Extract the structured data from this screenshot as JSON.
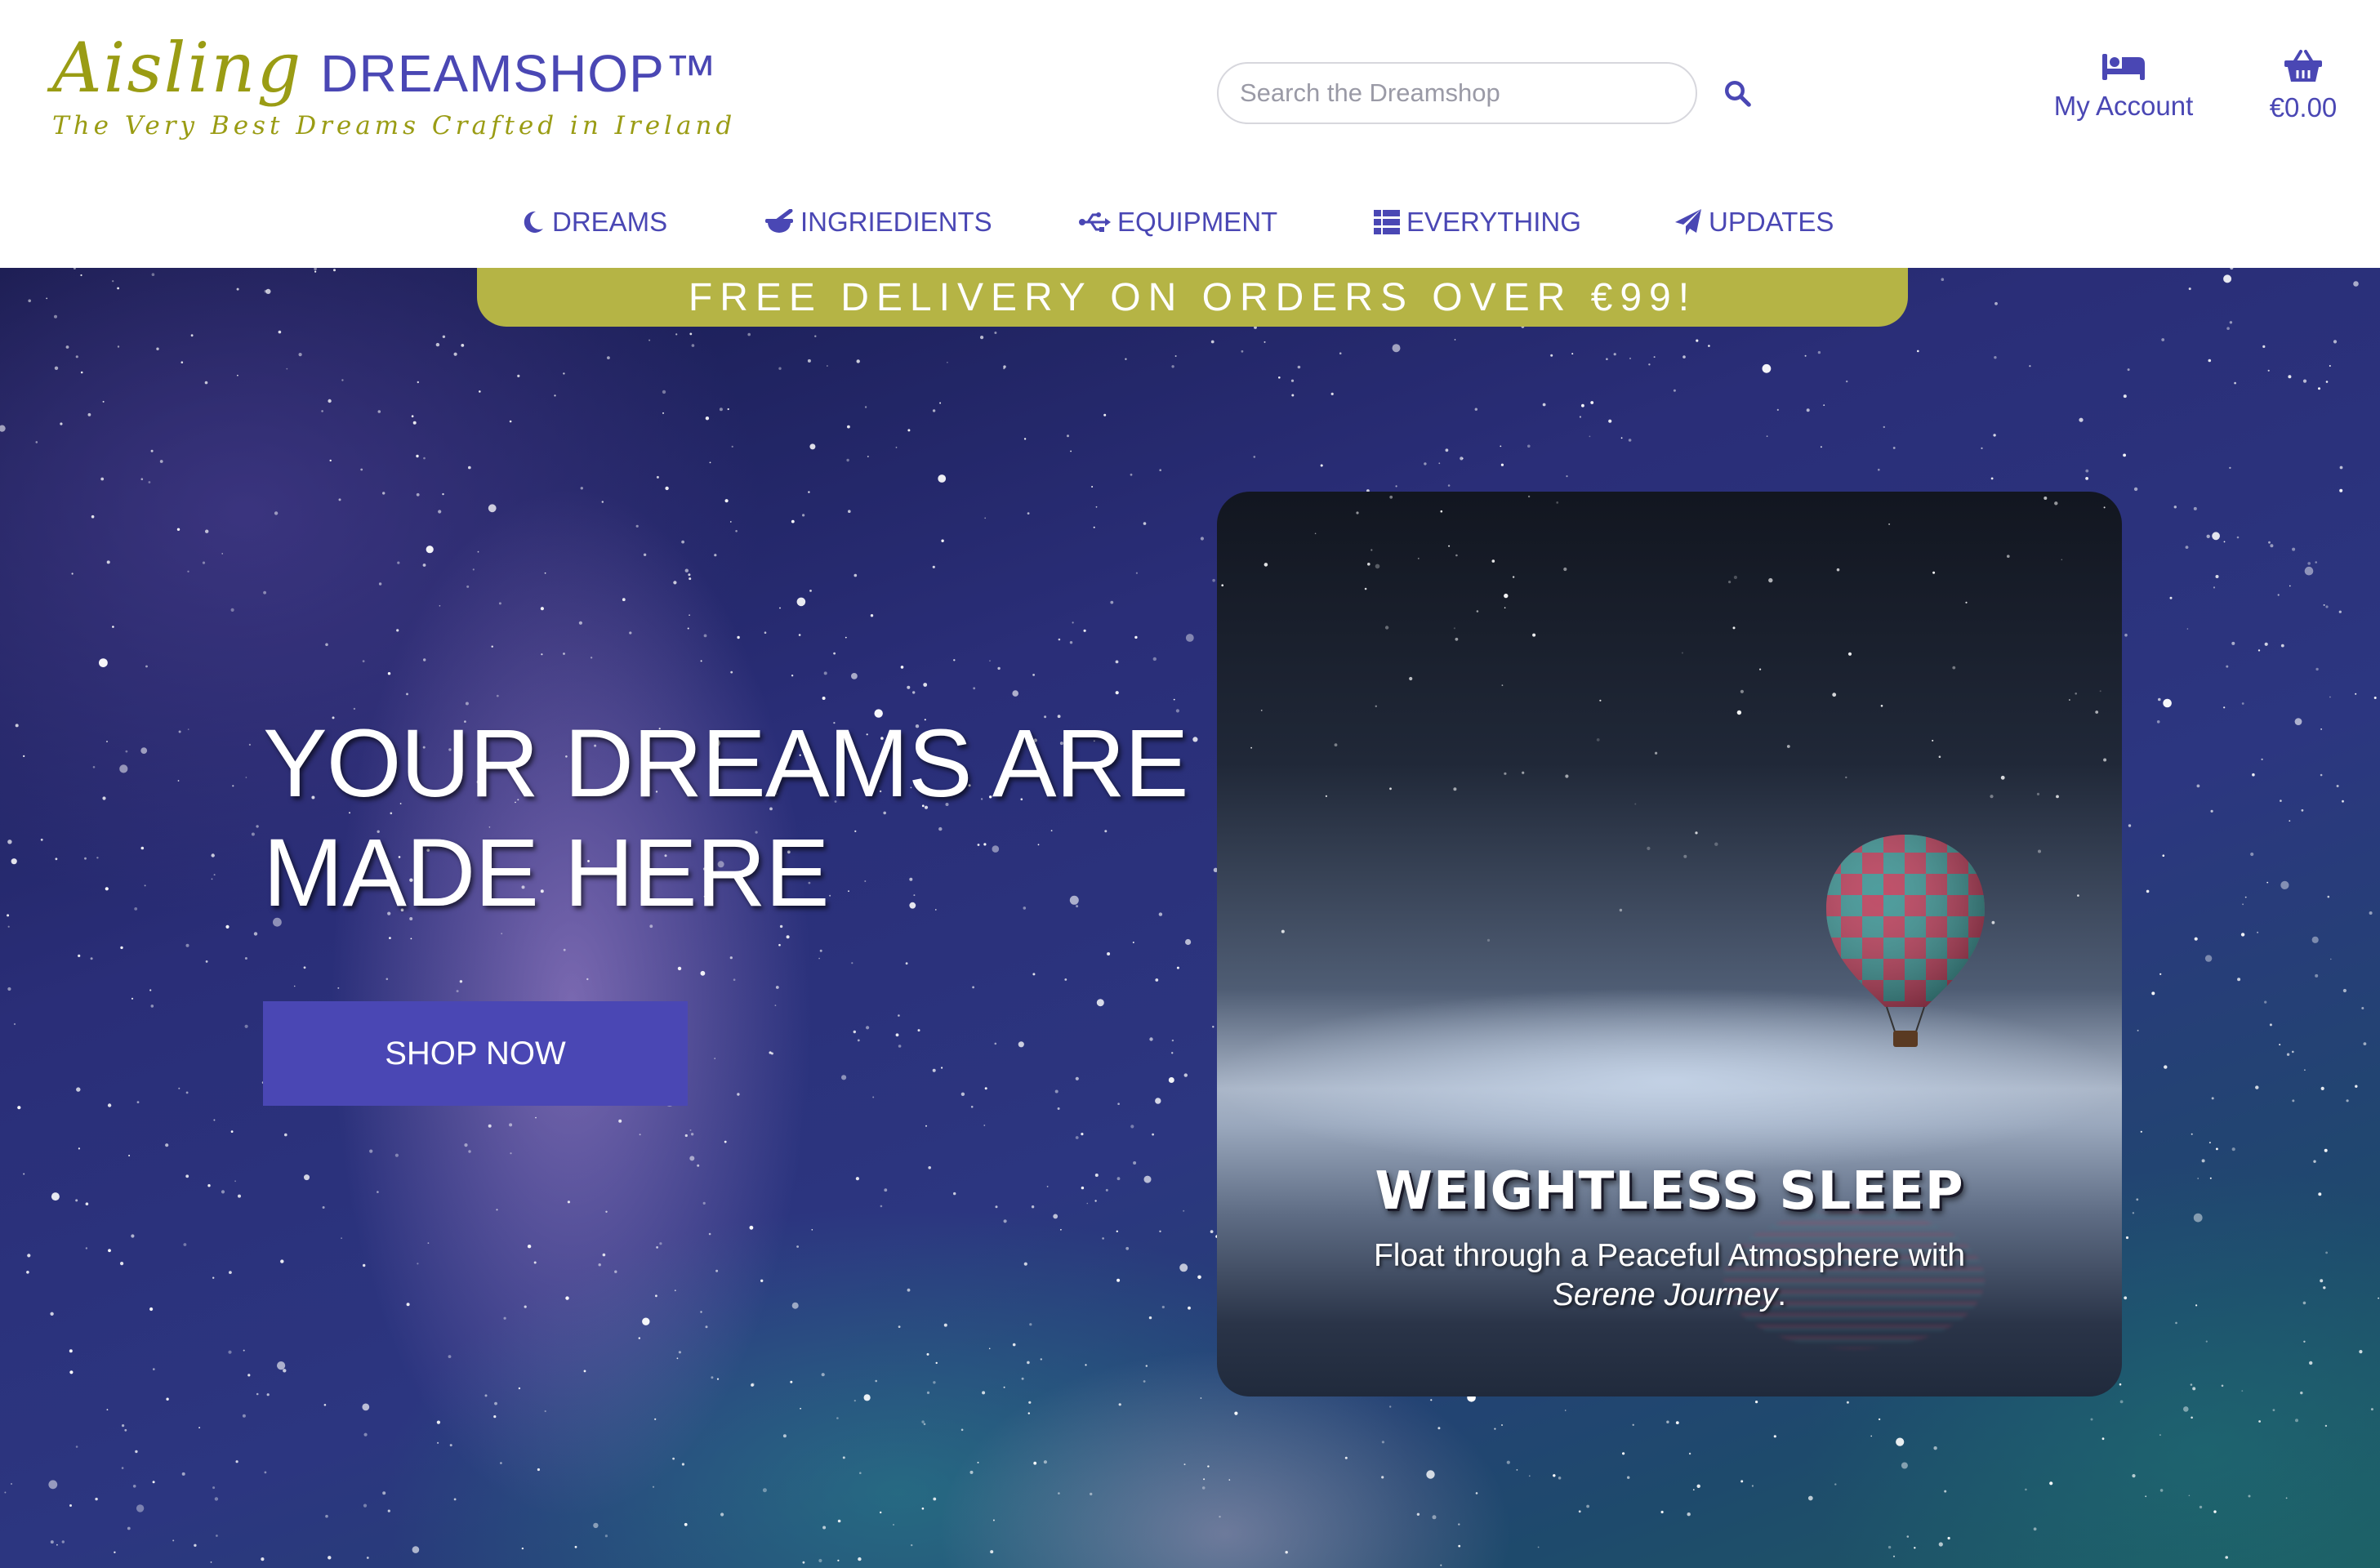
{
  "header": {
    "brand_script": "Aisling",
    "brand_name": "DREAMSHOP™",
    "tagline": "The Very Best Dreams Crafted in Ireland",
    "search_placeholder": "Search the Dreamshop",
    "account_label": "My Account",
    "cart_total": "€0.00"
  },
  "nav": [
    {
      "label": "DREAMS",
      "icon": "moon-icon"
    },
    {
      "label": "INGRIEDIENTS",
      "icon": "mortar-pestle-icon"
    },
    {
      "label": "EQUIPMENT",
      "icon": "usb-icon"
    },
    {
      "label": "EVERYTHING",
      "icon": "grid-icon"
    },
    {
      "label": "UPDATES",
      "icon": "paper-plane-icon"
    }
  ],
  "promo": "FREE DELIVERY ON ORDERS OVER €99!",
  "hero": {
    "title": "YOUR DREAMS ARE MADE HERE",
    "cta": "SHOP NOW",
    "card": {
      "title": "WEIGHTLESS SLEEP",
      "subtitle_line1": "Float through a Peaceful Atmosphere with",
      "subtitle_emphasis": "Serene Journey",
      "subtitle_end": "."
    }
  },
  "colors": {
    "brand_purple": "#4a47b4",
    "brand_olive": "#9a9c14",
    "promo_bar": "#b5b445"
  }
}
